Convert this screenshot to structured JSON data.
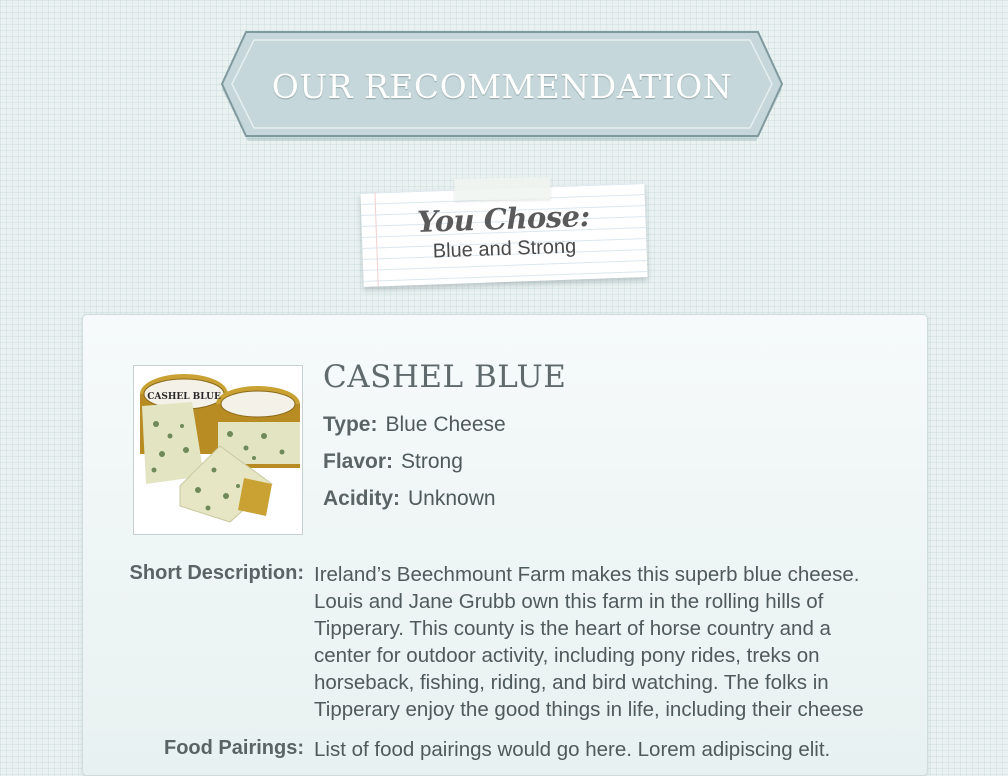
{
  "banner": {
    "title": "OUR RECOMMENDATION"
  },
  "selection_note": {
    "heading": "You Chose:",
    "choice": "Blue and Strong"
  },
  "cheese": {
    "name": "CASHEL BLUE",
    "photo_label": "CASHEL BLUE",
    "attributes": [
      {
        "label": "Type:",
        "value": "Blue Cheese"
      },
      {
        "label": "Flavor:",
        "value": "Strong"
      },
      {
        "label": "Acidity:",
        "value": "Unknown"
      }
    ],
    "short_description_label": "Short Description:",
    "short_description": "Ireland’s Beechmount Farm makes this superb blue cheese. Louis and Jane Grubb own this farm in the rolling hills of Tipperary. This county is the heart of horse country and a center for outdoor activity, including pony rides, treks on horseback, fishing, riding, and bird watching. The folks in Tipperary enjoy the good things in life, including their cheese",
    "food_pairings_label": "Food Pairings:",
    "food_pairings": "List of food pairings would go here. Lorem adipiscing elit."
  },
  "colors": {
    "page_background": "#e9f1f1",
    "banner_fill": "#c5d7da",
    "banner_border": "#7f9a9f",
    "card_background": "#f3f8f8",
    "text": "#4f5a5c"
  }
}
